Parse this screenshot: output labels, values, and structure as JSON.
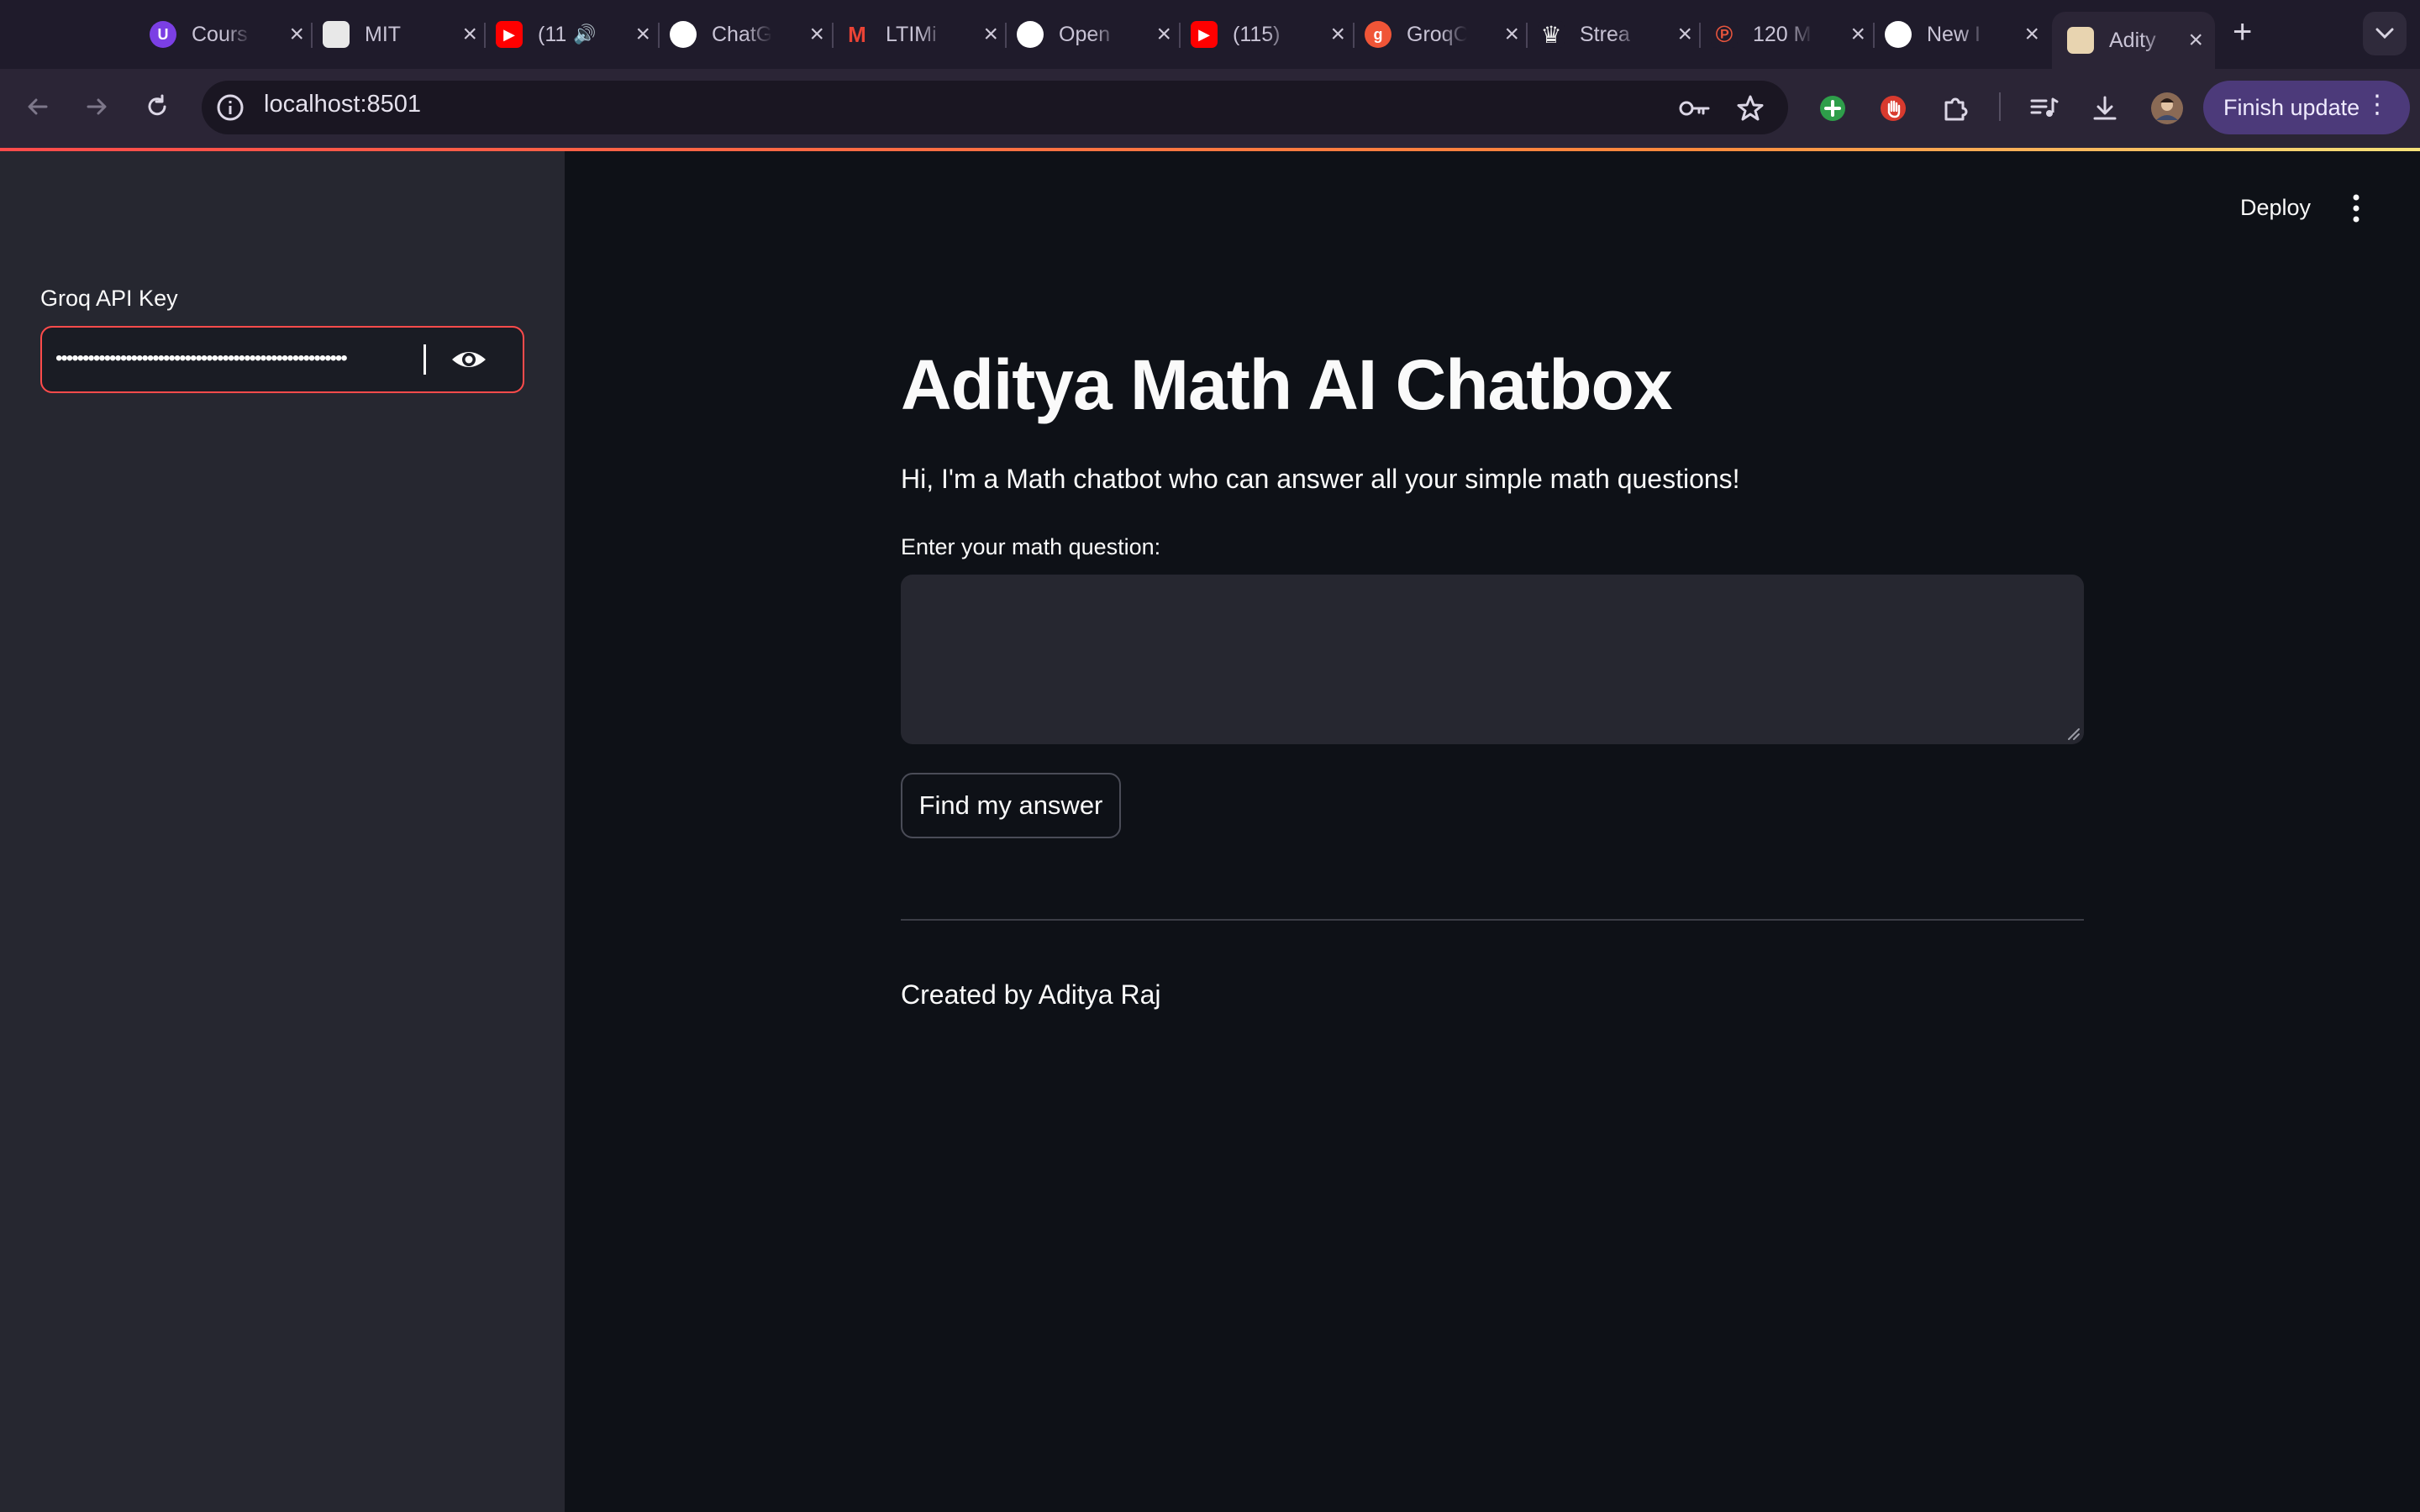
{
  "tabs": [
    {
      "title": "Cours",
      "favicon": "university-icon",
      "color": "#7b3fe4",
      "glyph": "U"
    },
    {
      "title": "MIT",
      "favicon": "mit-logo-icon",
      "color": "#e8e8e8",
      "glyph": ""
    },
    {
      "title": "(11",
      "favicon": "youtube-icon",
      "color": "#ff0000",
      "glyph": "▶",
      "audio": true
    },
    {
      "title": "ChatG",
      "favicon": "openai-icon",
      "color": "#ffffff",
      "glyph": ""
    },
    {
      "title": "LTIMi",
      "favicon": "gmail-icon",
      "color": "#ea4335",
      "glyph": "M"
    },
    {
      "title": "Open",
      "favicon": "github-icon",
      "color": "#ffffff",
      "glyph": ""
    },
    {
      "title": "(115)",
      "favicon": "youtube-icon",
      "color": "#ff0000",
      "glyph": "▶"
    },
    {
      "title": "GroqC",
      "favicon": "groq-icon",
      "color": "#f05537",
      "glyph": "g"
    },
    {
      "title": "Strea",
      "favicon": "crown-icon",
      "color": "#1f1b2b",
      "glyph": "♛"
    },
    {
      "title": "120 M",
      "favicon": "pinterest-icon",
      "color": "#1f1b2b",
      "glyph": "℗"
    },
    {
      "title": "New I",
      "favicon": "github-icon",
      "color": "#ffffff",
      "glyph": ""
    },
    {
      "title": "Adity",
      "favicon": "streamlit-icon",
      "color": "#e8d4b0",
      "glyph": "",
      "active": true
    }
  ],
  "toolbar": {
    "url": "localhost:8501",
    "finish_update_label": "Finish update"
  },
  "sidebar": {
    "api_key_label": "Groq API Key",
    "api_key_value": "••••••••••••••••••••••••••••••••••••••••••••••••••••••"
  },
  "header": {
    "deploy_label": "Deploy"
  },
  "main": {
    "title": "Aditya Math AI Chatbox",
    "subtitle": "Hi, I'm a Math chatbot who can answer all your simple math questions!",
    "question_label": "Enter your math question:",
    "question_value": "",
    "button_label": "Find my answer",
    "footer": "Created by Aditya Raj"
  },
  "colors": {
    "accent": "#ff4b4b",
    "sidebar_bg": "#262730",
    "main_bg": "#0e1117",
    "finish_bg": "#4c3a7a"
  }
}
